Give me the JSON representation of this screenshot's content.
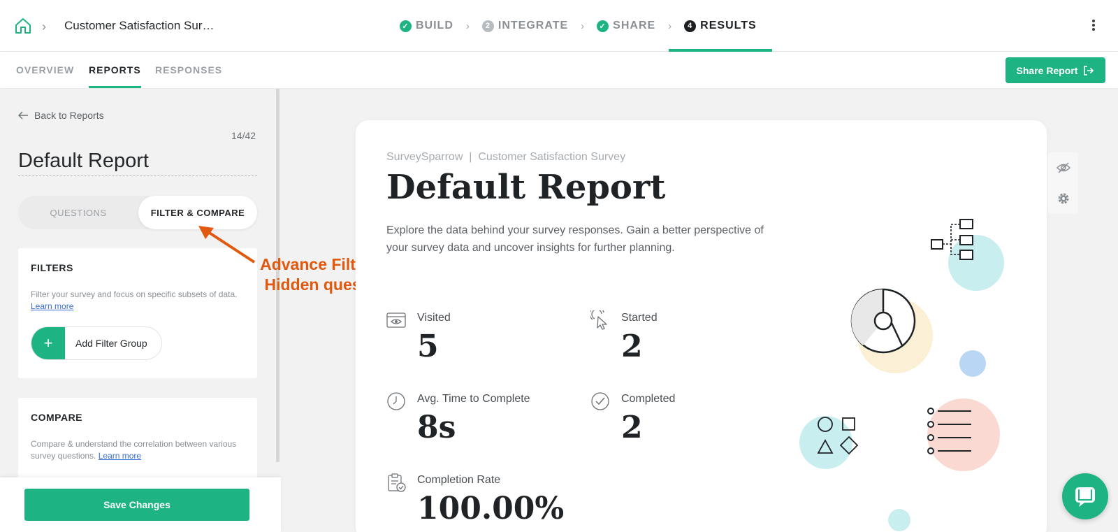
{
  "header": {
    "survey_title": "Customer Satisfaction Sur…",
    "steps": [
      {
        "label": "BUILD",
        "badge": "✓",
        "state": "done"
      },
      {
        "label": "INTEGRATE",
        "badge": "2",
        "state": "pending"
      },
      {
        "label": "SHARE",
        "badge": "✓",
        "state": "done"
      },
      {
        "label": "RESULTS",
        "badge": "4",
        "state": "active"
      }
    ]
  },
  "subnav": {
    "tabs": [
      "OVERVIEW",
      "REPORTS",
      "RESPONSES"
    ],
    "active_tab": "REPORTS",
    "share_label": "Share Report"
  },
  "sidebar": {
    "back_label": "Back to Reports",
    "count": "14/42",
    "report_name": "Default Report",
    "toggle": {
      "questions": "QUESTIONS",
      "filter_compare": "FILTER & COMPARE"
    },
    "filters": {
      "title": "FILTERS",
      "description": "Filter your survey and focus on specific subsets of data.",
      "learn_more": "Learn more",
      "add_label": "Add Filter Group"
    },
    "compare": {
      "title": "COMPARE",
      "description": "Compare & understand the correlation between various survey questions.",
      "learn_more": "Learn more"
    },
    "save_label": "Save Changes"
  },
  "annotation": {
    "line1": "Advance Filter and",
    "line2": "Hidden questions"
  },
  "report": {
    "subtitle": "SurveySparrow  |  Customer Satisfaction Survey",
    "title": "Default Report",
    "description": "Explore the data behind your survey responses. Gain a better perspective of your survey data and uncover insights for further planning.",
    "stats": {
      "visited": {
        "label": "Visited",
        "value": "5"
      },
      "started": {
        "label": "Started",
        "value": "2"
      },
      "avg_time": {
        "label": "Avg. Time to Complete",
        "value": "8s"
      },
      "completed": {
        "label": "Completed",
        "value": "2"
      },
      "completion_rate": {
        "label": "Completion Rate",
        "value": "100.00%"
      }
    }
  },
  "colors": {
    "brand": "#1eb382",
    "annotation": "#e0590f"
  }
}
